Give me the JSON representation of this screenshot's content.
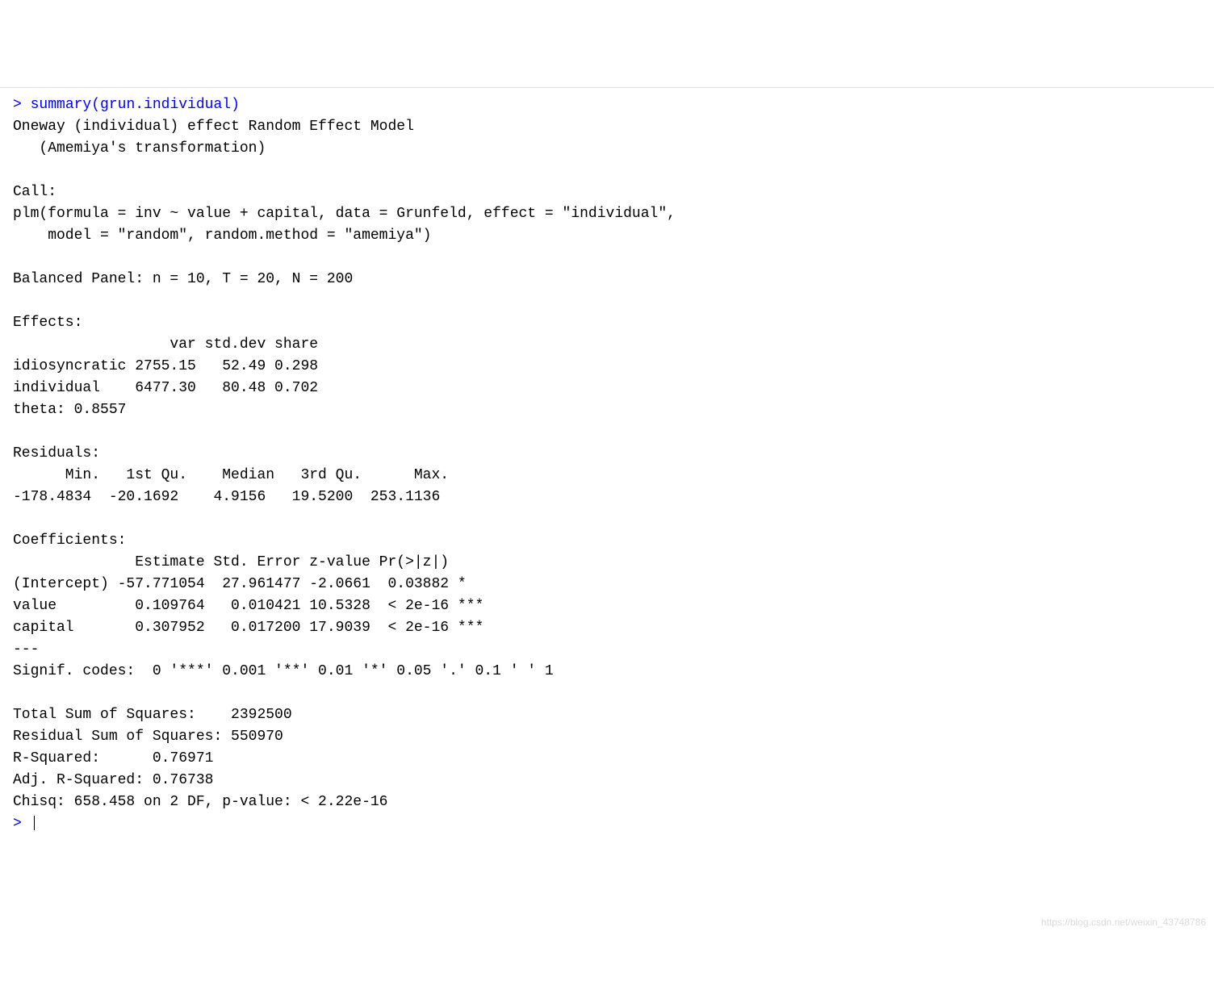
{
  "prompt_char": ">",
  "command": "summary(grun.individual)",
  "output": {
    "model_title": "Oneway (individual) effect Random Effect Model",
    "transformation": "   (Amemiya's transformation)",
    "call_label": "Call:",
    "call_line1": "plm(formula = inv ~ value + capital, data = Grunfeld, effect = \"individual\", ",
    "call_line2": "    model = \"random\", random.method = \"amemiya\")",
    "panel_info": "Balanced Panel: n = 10, T = 20, N = 200",
    "effects_label": "Effects:",
    "effects_header": "                  var std.dev share",
    "effects_idio": "idiosyncratic 2755.15   52.49 0.298",
    "effects_indiv": "individual    6477.30   80.48 0.702",
    "theta": "theta: 0.8557",
    "residuals_label": "Residuals:",
    "residuals_header": "      Min.   1st Qu.    Median   3rd Qu.      Max. ",
    "residuals_values": "-178.4834  -20.1692    4.9156   19.5200  253.1136 ",
    "coef_label": "Coefficients:",
    "coef_header": "              Estimate Std. Error z-value Pr(>|z|)    ",
    "coef_intercept": "(Intercept) -57.771054  27.961477 -2.0661  0.03882 *  ",
    "coef_value": "value         0.109764   0.010421 10.5328  < 2e-16 ***",
    "coef_capital": "capital       0.307952   0.017200 17.9039  < 2e-16 ***",
    "coef_sep": "---",
    "signif_codes": "Signif. codes:  0 '***' 0.001 '**' 0.01 '*' 0.05 '.' 0.1 ' ' 1",
    "total_ss": "Total Sum of Squares:    2392500",
    "residual_ss": "Residual Sum of Squares: 550970",
    "r_squared": "R-Squared:      0.76971",
    "adj_r_sq": "Adj. R-Squared: 0.76738",
    "chisq": "Chisq: 658.458 on 2 DF, p-value: < 2.22e-16"
  },
  "watermark": "https://blog.csdn.net/weixin_43748786"
}
